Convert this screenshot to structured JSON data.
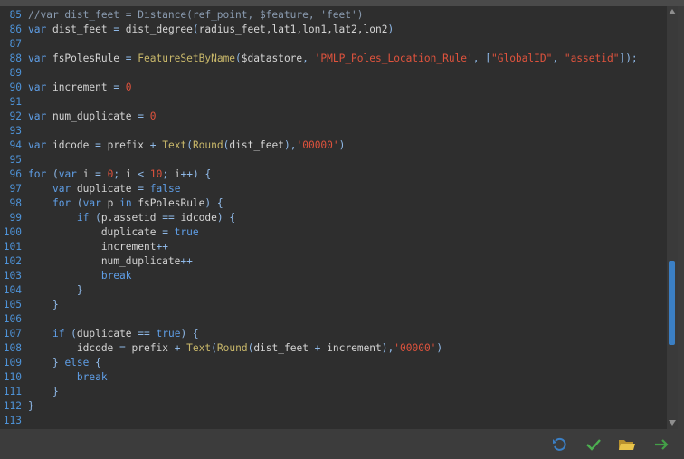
{
  "lines": [
    {
      "n": "85",
      "t": [
        [
          "cmt",
          "//var dist_feet = Distance(ref_point, $feature, 'feet')"
        ]
      ]
    },
    {
      "n": "86",
      "t": [
        [
          "kw",
          "var"
        ],
        [
          "id",
          " dist_feet "
        ],
        [
          "op",
          "="
        ],
        [
          "id",
          " dist_degree"
        ],
        [
          "op",
          "("
        ],
        [
          "id",
          "radius_feet,lat1,lon1,lat2,lon2"
        ],
        [
          "op",
          ")"
        ]
      ]
    },
    {
      "n": "87",
      "t": []
    },
    {
      "n": "88",
      "t": [
        [
          "kw",
          "var"
        ],
        [
          "id",
          " fsPolesRule "
        ],
        [
          "op",
          "="
        ],
        [
          "fn",
          " FeatureSetByName"
        ],
        [
          "op",
          "("
        ],
        [
          "id",
          "$datastore"
        ],
        [
          "op",
          ", "
        ],
        [
          "str",
          "'PMLP_Poles_Location_Rule'"
        ],
        [
          "op",
          ", ["
        ],
        [
          "str",
          "\"GlobalID\""
        ],
        [
          "op",
          ", "
        ],
        [
          "str",
          "\"assetid\""
        ],
        [
          "op",
          "]);"
        ]
      ]
    },
    {
      "n": "89",
      "t": []
    },
    {
      "n": "90",
      "t": [
        [
          "kw",
          "var"
        ],
        [
          "id",
          " increment "
        ],
        [
          "op",
          "="
        ],
        [
          "num",
          " 0"
        ]
      ]
    },
    {
      "n": "91",
      "t": []
    },
    {
      "n": "92",
      "t": [
        [
          "kw",
          "var"
        ],
        [
          "id",
          " num_duplicate "
        ],
        [
          "op",
          "="
        ],
        [
          "num",
          " 0"
        ]
      ]
    },
    {
      "n": "93",
      "t": []
    },
    {
      "n": "94",
      "t": [
        [
          "kw",
          "var"
        ],
        [
          "id",
          " idcode "
        ],
        [
          "op",
          "="
        ],
        [
          "id",
          " prefix "
        ],
        [
          "op",
          "+"
        ],
        [
          "fn",
          " Text"
        ],
        [
          "op",
          "("
        ],
        [
          "fn",
          "Round"
        ],
        [
          "op",
          "("
        ],
        [
          "id",
          "dist_feet"
        ],
        [
          "op",
          "),"
        ],
        [
          "str",
          "'00000'"
        ],
        [
          "op",
          ")"
        ]
      ]
    },
    {
      "n": "95",
      "t": []
    },
    {
      "n": "96",
      "t": [
        [
          "kw",
          "for"
        ],
        [
          "op",
          " ("
        ],
        [
          "kw",
          "var"
        ],
        [
          "id",
          " i "
        ],
        [
          "op",
          "="
        ],
        [
          "num",
          " 0"
        ],
        [
          "op",
          "; "
        ],
        [
          "id",
          "i "
        ],
        [
          "op",
          "<"
        ],
        [
          "num",
          " 10"
        ],
        [
          "op",
          "; "
        ],
        [
          "id",
          "i"
        ],
        [
          "op",
          "++) {"
        ]
      ]
    },
    {
      "n": "97",
      "t": [
        [
          "id",
          "    "
        ],
        [
          "kw",
          "var"
        ],
        [
          "id",
          " duplicate "
        ],
        [
          "op",
          "="
        ],
        [
          "kw",
          " false"
        ]
      ]
    },
    {
      "n": "98",
      "t": [
        [
          "id",
          "    "
        ],
        [
          "kw",
          "for"
        ],
        [
          "op",
          " ("
        ],
        [
          "kw",
          "var"
        ],
        [
          "id",
          " p "
        ],
        [
          "kw",
          "in"
        ],
        [
          "id",
          " fsPolesRule"
        ],
        [
          "op",
          ") {"
        ]
      ]
    },
    {
      "n": "99",
      "t": [
        [
          "id",
          "        "
        ],
        [
          "kw",
          "if"
        ],
        [
          "op",
          " ("
        ],
        [
          "id",
          "p.assetid "
        ],
        [
          "op",
          "=="
        ],
        [
          "id",
          " idcode"
        ],
        [
          "op",
          ") {"
        ]
      ]
    },
    {
      "n": "100",
      "t": [
        [
          "id",
          "            duplicate "
        ],
        [
          "op",
          "="
        ],
        [
          "kw",
          " true"
        ]
      ]
    },
    {
      "n": "101",
      "t": [
        [
          "id",
          "            increment"
        ],
        [
          "op",
          "++"
        ]
      ]
    },
    {
      "n": "102",
      "t": [
        [
          "id",
          "            num_duplicate"
        ],
        [
          "op",
          "++"
        ]
      ]
    },
    {
      "n": "103",
      "t": [
        [
          "id",
          "            "
        ],
        [
          "kw",
          "break"
        ]
      ]
    },
    {
      "n": "104",
      "t": [
        [
          "id",
          "        "
        ],
        [
          "op",
          "}"
        ]
      ]
    },
    {
      "n": "105",
      "t": [
        [
          "id",
          "    "
        ],
        [
          "op",
          "}"
        ]
      ]
    },
    {
      "n": "106",
      "t": []
    },
    {
      "n": "107",
      "t": [
        [
          "id",
          "    "
        ],
        [
          "kw",
          "if"
        ],
        [
          "op",
          " ("
        ],
        [
          "id",
          "duplicate "
        ],
        [
          "op",
          "=="
        ],
        [
          "kw",
          " true"
        ],
        [
          "op",
          ") {"
        ]
      ]
    },
    {
      "n": "108",
      "t": [
        [
          "id",
          "        idcode "
        ],
        [
          "op",
          "="
        ],
        [
          "id",
          " prefix "
        ],
        [
          "op",
          "+"
        ],
        [
          "fn",
          " Text"
        ],
        [
          "op",
          "("
        ],
        [
          "fn",
          "Round"
        ],
        [
          "op",
          "("
        ],
        [
          "id",
          "dist_feet "
        ],
        [
          "op",
          "+"
        ],
        [
          "id",
          " increment"
        ],
        [
          "op",
          "),"
        ],
        [
          "str",
          "'00000'"
        ],
        [
          "op",
          ")"
        ]
      ]
    },
    {
      "n": "109",
      "t": [
        [
          "id",
          "    "
        ],
        [
          "op",
          "} "
        ],
        [
          "kw",
          "else"
        ],
        [
          "op",
          " {"
        ]
      ]
    },
    {
      "n": "110",
      "t": [
        [
          "id",
          "        "
        ],
        [
          "kw",
          "break"
        ]
      ]
    },
    {
      "n": "111",
      "t": [
        [
          "id",
          "    "
        ],
        [
          "op",
          "}"
        ]
      ]
    },
    {
      "n": "112",
      "t": [
        [
          "op",
          "}"
        ]
      ]
    },
    {
      "n": "113",
      "t": []
    }
  ],
  "colors": {
    "background": "#2e2e2e",
    "line_number": "#4e93d8",
    "keyword": "#5f9ee6",
    "function": "#c9b86a",
    "string": "#e0533d",
    "accent": "#3b7fc4",
    "check_green": "#4caf50",
    "folder_yellow": "#e8c44a",
    "arrow_green": "#43a047"
  },
  "icons": [
    "undo-icon",
    "check-icon",
    "folder-open-icon",
    "arrow-right-icon"
  ]
}
